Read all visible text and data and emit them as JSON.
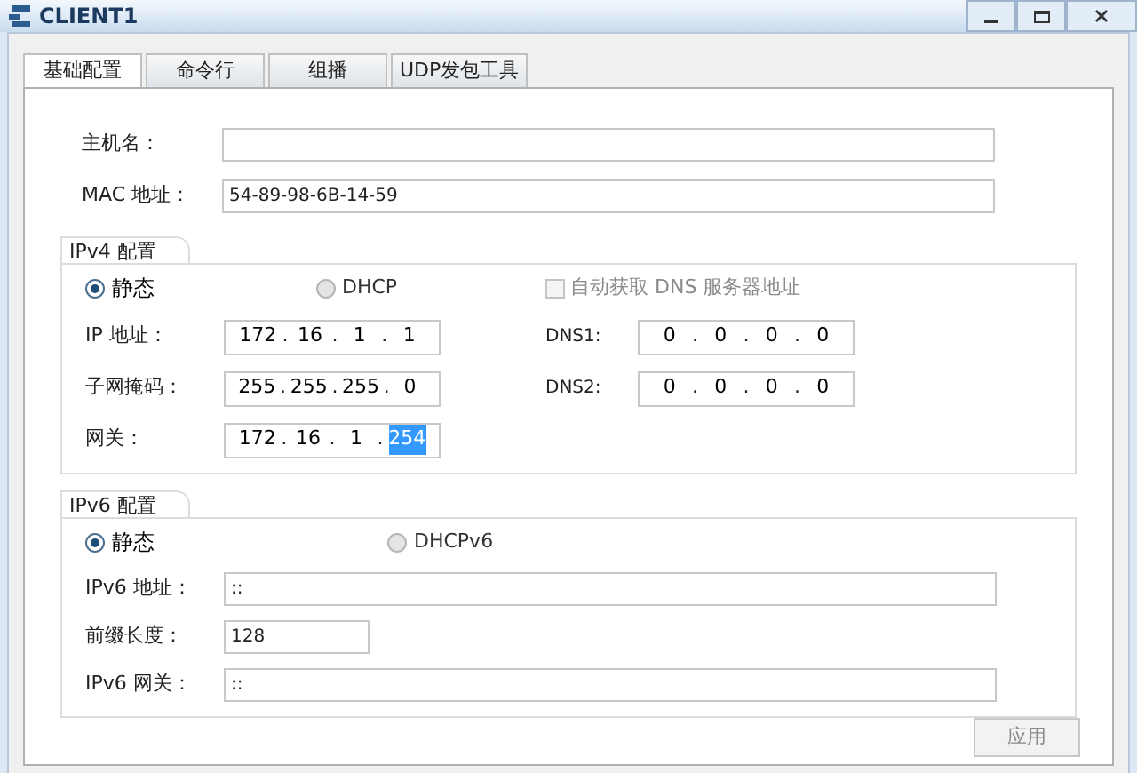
{
  "window": {
    "title": "CLIENT1"
  },
  "tabs": [
    {
      "label": "基础配置",
      "selected": true
    },
    {
      "label": "命令行",
      "selected": false
    },
    {
      "label": "组播",
      "selected": false
    },
    {
      "label": "UDP发包工具",
      "selected": false
    }
  ],
  "basic": [
    {
      "label": "主机名："
    },
    {
      "label": "MAC 地址：",
      "value": "54-89-98-6B-14-59"
    }
  ],
  "ipv4": {
    "title": "IPv4 配置",
    "octet_separator": ".",
    "modes": [
      {
        "label": "静态",
        "selected": true
      },
      {
        "label": "DHCP",
        "selected": false
      }
    ],
    "auto_dns": {
      "label": "自动获取 DNS 服务器地址",
      "checked": false,
      "disabled": true
    },
    "fields": [
      {
        "label": "IP 地址：",
        "octets": [
          {
            "text": "172",
            "selected": false
          },
          {
            "text": "16",
            "selected": false
          },
          {
            "text": "1",
            "selected": false
          },
          {
            "text": "1",
            "selected": false
          }
        ]
      },
      {
        "label": "子网掩码：",
        "octets": [
          {
            "text": "255",
            "selected": false
          },
          {
            "text": "255",
            "selected": false
          },
          {
            "text": "255",
            "selected": false
          },
          {
            "text": "0",
            "selected": false
          }
        ]
      },
      {
        "label": "网关：",
        "octets": [
          {
            "text": "172",
            "selected": false
          },
          {
            "text": "16",
            "selected": false
          },
          {
            "text": "1",
            "selected": false
          },
          {
            "text": "254",
            "selected": true
          }
        ]
      }
    ],
    "dns": [
      {
        "label": "DNS1:",
        "octets": [
          {
            "text": "0",
            "selected": false
          },
          {
            "text": "0",
            "selected": false
          },
          {
            "text": "0",
            "selected": false
          },
          {
            "text": "0",
            "selected": false
          }
        ]
      },
      {
        "label": "DNS2:",
        "octets": [
          {
            "text": "0",
            "selected": false
          },
          {
            "text": "0",
            "selected": false
          },
          {
            "text": "0",
            "selected": false
          },
          {
            "text": "0",
            "selected": false
          }
        ]
      }
    ]
  },
  "ipv6": {
    "title": "IPv6 配置",
    "modes": [
      {
        "label": "静态",
        "selected": true
      },
      {
        "label": "DHCPv6",
        "selected": false
      }
    ],
    "fields": [
      {
        "label": "IPv6 地址：",
        "value": "::",
        "kind": "wide"
      },
      {
        "label": "前缀长度：",
        "value": "128",
        "kind": "short"
      },
      {
        "label": "IPv6 网关：",
        "value": "::",
        "kind": "wide"
      }
    ]
  },
  "apply": {
    "label": "应用",
    "disabled": true
  }
}
